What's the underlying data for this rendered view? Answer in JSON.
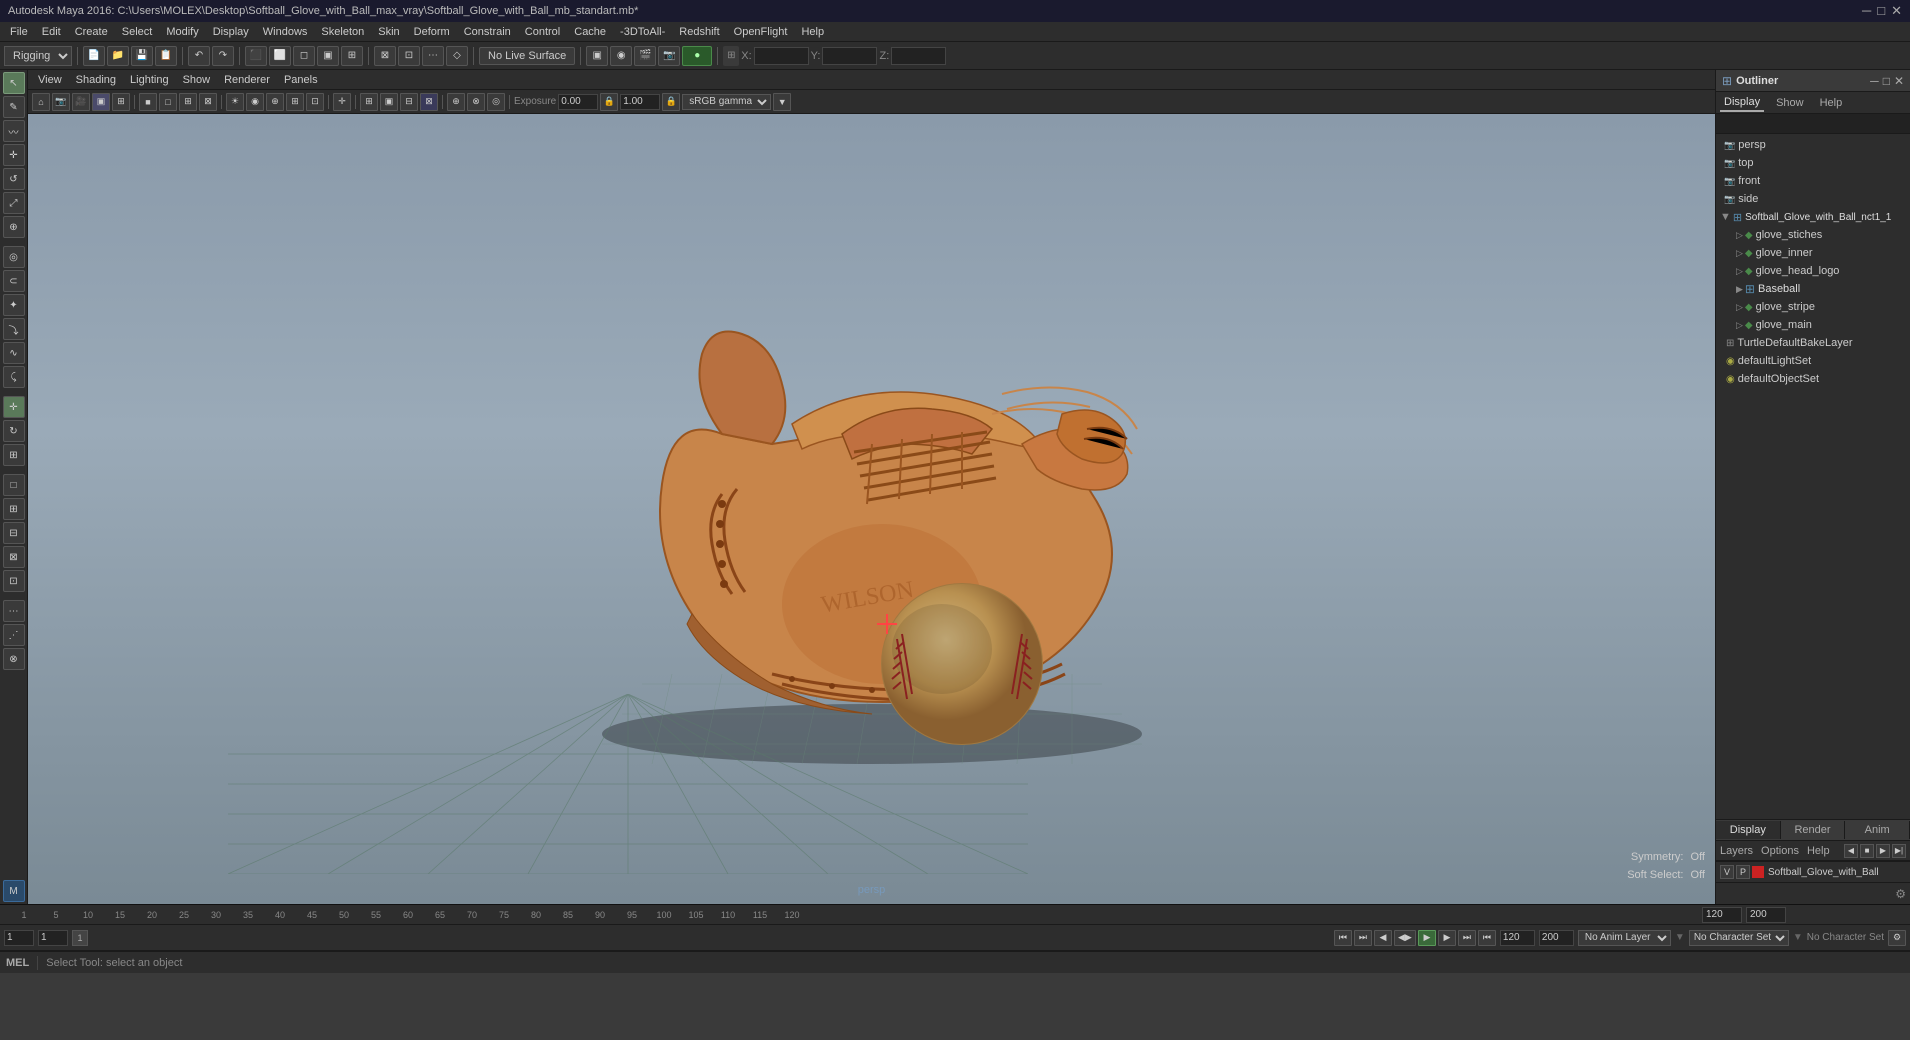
{
  "window": {
    "title": "Autodesk Maya 2016: C:\\Users\\MOLEX\\Desktop\\Softball_Glove_with_Ball_max_vray\\Softball_Glove_with_Ball_mb_standart.mb*",
    "controls": [
      "─",
      "□",
      "✕"
    ]
  },
  "menu": {
    "items": [
      "File",
      "Edit",
      "Create",
      "Select",
      "Modify",
      "Display",
      "Windows",
      "Skeleton",
      "Skin",
      "Deform",
      "Constrain",
      "Control",
      "Cache",
      "-3DToAll-",
      "Redshift",
      "OpenFlight",
      "Help"
    ]
  },
  "toolbar": {
    "rigging_label": "Rigging",
    "no_live_surface": "No Live Surface",
    "x_coord": "X:",
    "y_coord": "Y:",
    "z_coord": "Z:"
  },
  "viewport": {
    "menus": [
      "View",
      "Shading",
      "Lighting",
      "Show",
      "Renderer",
      "Panels"
    ],
    "value1": "0.00",
    "value2": "1.00",
    "color_space": "sRGB gamma",
    "label": "persp"
  },
  "outliner": {
    "title": "Outliner",
    "tabs": [
      "Display",
      "Show",
      "Help"
    ],
    "tree_items": [
      {
        "label": "persp",
        "type": "camera",
        "indent": 0
      },
      {
        "label": "top",
        "type": "camera",
        "indent": 0
      },
      {
        "label": "front",
        "type": "camera",
        "indent": 0
      },
      {
        "label": "side",
        "type": "camera",
        "indent": 0
      },
      {
        "label": "Softball_Glove_with_Ball_nct1_1",
        "type": "group",
        "indent": 0
      },
      {
        "label": "glove_stiches",
        "type": "mesh",
        "indent": 2
      },
      {
        "label": "glove_inner",
        "type": "mesh",
        "indent": 2
      },
      {
        "label": "glove_head_logo",
        "type": "mesh",
        "indent": 2
      },
      {
        "label": "Baseball",
        "type": "group",
        "indent": 2
      },
      {
        "label": "glove_stripe",
        "type": "mesh",
        "indent": 2
      },
      {
        "label": "glove_main",
        "type": "mesh",
        "indent": 2
      },
      {
        "label": "TurtleDefaultBakeLayer",
        "type": "layer",
        "indent": 0
      },
      {
        "label": "defaultLightSet",
        "type": "light",
        "indent": 0
      },
      {
        "label": "defaultObjectSet",
        "type": "mesh",
        "indent": 0
      }
    ],
    "bottom_tabs": [
      "Display",
      "Render",
      "Anim"
    ],
    "bottom_options": [
      "Layers",
      "Options",
      "Help"
    ]
  },
  "layer_entry": {
    "v_label": "V",
    "p_label": "P",
    "name": "Softball_Glove_with_Ball"
  },
  "timeline": {
    "frame_start": "1",
    "frame_current": "1",
    "frame_end": "120",
    "range_start": "1",
    "range_end": "200",
    "marks": [
      "1",
      "5",
      "10",
      "15",
      "20",
      "25",
      "30",
      "35",
      "40",
      "45",
      "50",
      "55",
      "60",
      "65",
      "70",
      "75",
      "80",
      "85",
      "90",
      "95",
      "100",
      "105",
      "110",
      "115",
      "120"
    ]
  },
  "playback": {
    "buttons": [
      "⏮",
      "⏭",
      "◀",
      "▶◀",
      "▶",
      "▶▶",
      "⏭"
    ]
  },
  "bottom_bar": {
    "anim_layer": "No Anim Layer",
    "char_set": "No Character Set",
    "mel_label": "MEL",
    "status": "Select Tool: select an object"
  },
  "symmetry": {
    "symmetry_label": "Symmetry:",
    "symmetry_value": "Off",
    "soft_select_label": "Soft Select:",
    "soft_select_value": "Off"
  }
}
